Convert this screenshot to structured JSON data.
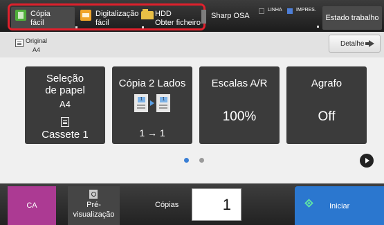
{
  "topbar": {
    "modes": [
      {
        "label": "Cópia\nfácil",
        "icon": "copy-icon",
        "selected": true
      },
      {
        "label": "Digitalização\nfácil",
        "icon": "scan-icon"
      },
      {
        "label": "HDD\nObter ficheiro",
        "icon": "hdd-folder-icon"
      }
    ],
    "osa_label": "Sharp OSA",
    "indicators": {
      "line": "LINHA",
      "print": "IMPRES."
    },
    "status_button": "Estado trabalho"
  },
  "original": {
    "label": "Original",
    "size": "A4"
  },
  "detail_button": "Detalhe",
  "tiles": [
    {
      "title": "Seleção\nde papel",
      "subtitle": "A4",
      "value": "Cassete 1"
    },
    {
      "title": "Cópia 2 Lados",
      "value": "1 → 1"
    },
    {
      "title": "Escalas A/R",
      "value": "100%"
    },
    {
      "title": "Agrafo",
      "value": "Off"
    }
  ],
  "duplex_pages": [
    "1",
    "1"
  ],
  "pager": {
    "pages": 2,
    "current": 1
  },
  "bottom": {
    "clear_all": "CA",
    "preview": "Pré-\nvisualização",
    "copies_label": "Cópias",
    "copies_value": "1",
    "start": "Iniciar"
  },
  "colors": {
    "accent_highlight": "#e0202c",
    "start": "#2b77cf",
    "clear_all": "#ac3a93",
    "led_print": "#4e7fd8"
  }
}
